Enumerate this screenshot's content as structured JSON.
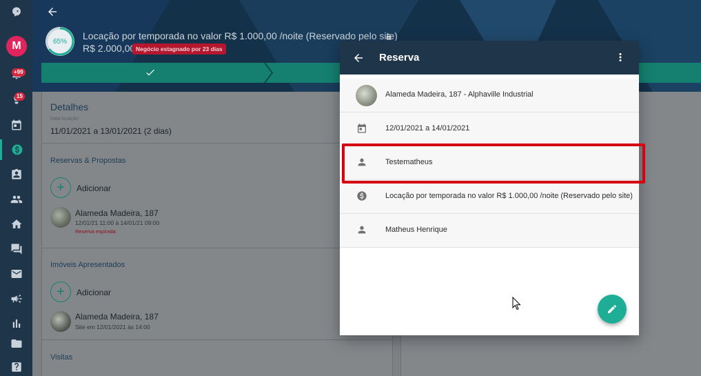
{
  "sidebar": {
    "avatar_letter": "M",
    "badges": {
      "notifications": "+99",
      "activity": "15"
    },
    "icons": [
      "logo-icon",
      "bell-icon",
      "rocket-icon",
      "calendar-icon",
      "money-icon",
      "contact-icon",
      "people-icon",
      "home-icon",
      "chat-icon",
      "mail-icon",
      "megaphone-icon",
      "chart-icon",
      "folder-icon",
      "help-icon"
    ]
  },
  "header": {
    "progress": "65%",
    "title": "Locação por temporada no valor R$ 1.000,00 /noite (Reservado pelo site)",
    "value": "R$ 2.000,00",
    "stagnant_badge": "Negócio estagnado por 23 dias"
  },
  "left_panel": {
    "title": "Detalhes",
    "faded_label": "Data locação",
    "date_range": "11/01/2021 a 13/01/2021 (2 dias)",
    "reservas": {
      "title": "Reservas & Propostas",
      "add_label": "Adicionar",
      "item_title": "Alameda Madeira, 187",
      "item_sub": "12/01/21 11:00 à 14/01/21 09:00",
      "item_status": "Reserva expirada"
    },
    "imoveis": {
      "title": "Imóveis Apresentados",
      "add_label": "Adicionar",
      "item_title": "Alameda Madeira, 187",
      "item_sub": "Site em 12/01/2021 às 14:00"
    },
    "visitas_title": "Visitas"
  },
  "modal": {
    "title": "Reserva",
    "rows": [
      {
        "icon": "property-thumbnail",
        "text": "Alameda Madeira, 187 - Alphaville Industrial"
      },
      {
        "icon": "calendar-icon",
        "text": "12/01/2021 a 14/01/2021"
      },
      {
        "icon": "person-icon",
        "text": "Testematheus"
      },
      {
        "icon": "money-icon",
        "text": "Locação por temporada no valor R$ 1.000,00 /noite (Reservado pelo site)"
      },
      {
        "icon": "person-icon",
        "text": "Matheus Henrique"
      }
    ]
  },
  "colors": {
    "accent": "#1eae95",
    "sidebar": "#1f3549",
    "highlight": "#d40012"
  }
}
